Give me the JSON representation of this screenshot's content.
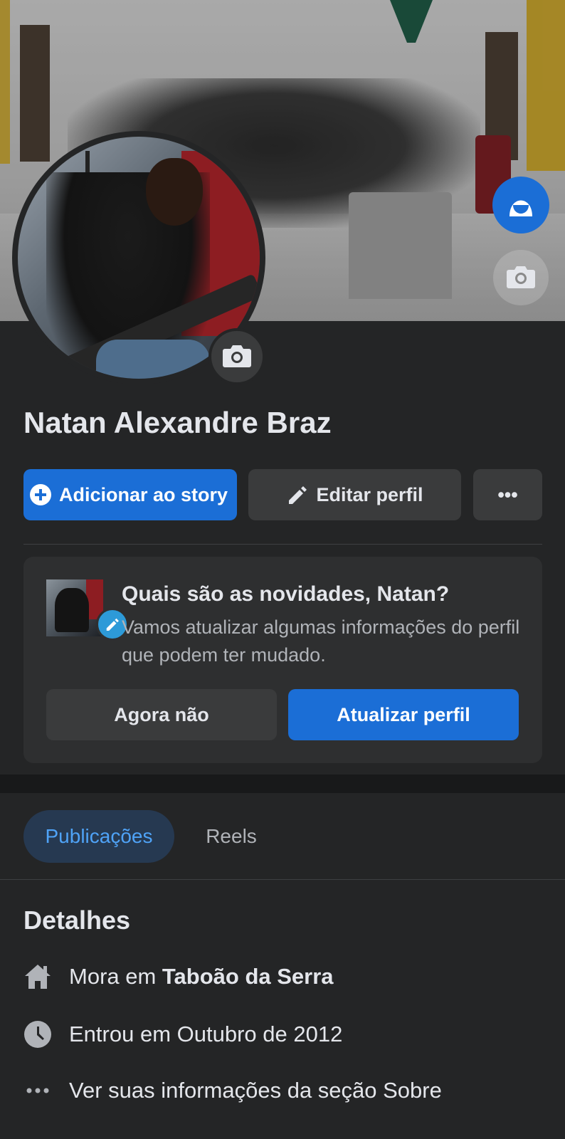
{
  "profile": {
    "name": "Natan Alexandre Braz"
  },
  "actions": {
    "add_story": "Adicionar ao story",
    "edit_profile": "Editar perfil",
    "more": "•••"
  },
  "update_card": {
    "title": "Quais são as novidades, Natan?",
    "body": "Vamos atualizar algumas informações do perfil que podem ter mudado.",
    "not_now": "Agora não",
    "update": "Atualizar perfil"
  },
  "tabs": [
    {
      "label": "Publicações",
      "active": true
    },
    {
      "label": "Reels",
      "active": false
    }
  ],
  "details": {
    "title": "Detalhes",
    "lives_prefix": "Mora em ",
    "lives_city": "Taboão da Serra",
    "joined": "Entrou em Outubro de 2012",
    "about": "Ver suas informações da seção Sobre"
  },
  "colors": {
    "accent": "#1b6ed6",
    "background": "#242526",
    "card": "#2e2f30",
    "tab_active_bg": "#263951",
    "tab_active_text": "#4fa3f7"
  },
  "icons": {
    "cover_avatar_button": "avatar-icon",
    "cover_camera": "camera-icon",
    "profile_camera": "camera-icon",
    "add_story": "plus-circle-icon",
    "edit_profile": "pencil-icon",
    "more": "more-dots-icon",
    "card_badge": "pencil-icon",
    "lives": "home-icon",
    "joined": "clock-icon",
    "about": "more-dots-icon"
  }
}
